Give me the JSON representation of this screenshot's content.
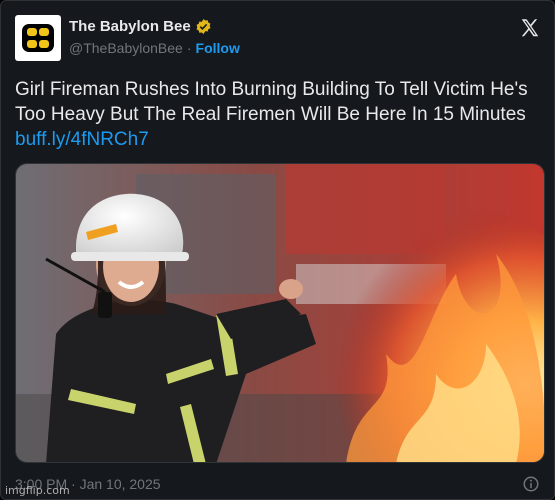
{
  "account": {
    "display_name": "The Babylon Bee",
    "handle": "@TheBabylonBee",
    "separator": "·",
    "follow_label": "Follow",
    "avatar_icon": "bee-logo-icon",
    "verified_icon": "verified-badge-icon",
    "verified_color": "#e2b719"
  },
  "platform_icon": "x-logo-icon",
  "tweet": {
    "text": "Girl Fireman Rushes Into Burning Building To Tell Victim He's Too Heavy But The Real Firemen Will Be Here In 15 Minutes",
    "link": "buff.ly/4fNRCh7"
  },
  "media": {
    "image_icon": "firefighter-photo"
  },
  "footer": {
    "timestamp": "3:00 PM · Jan 10, 2025",
    "info_icon": "info-icon"
  },
  "watermark": "imgflip.com",
  "colors": {
    "background": "#15181c",
    "link": "#1d9bf0",
    "muted": "#71767b",
    "text": "#e7e9ea"
  }
}
